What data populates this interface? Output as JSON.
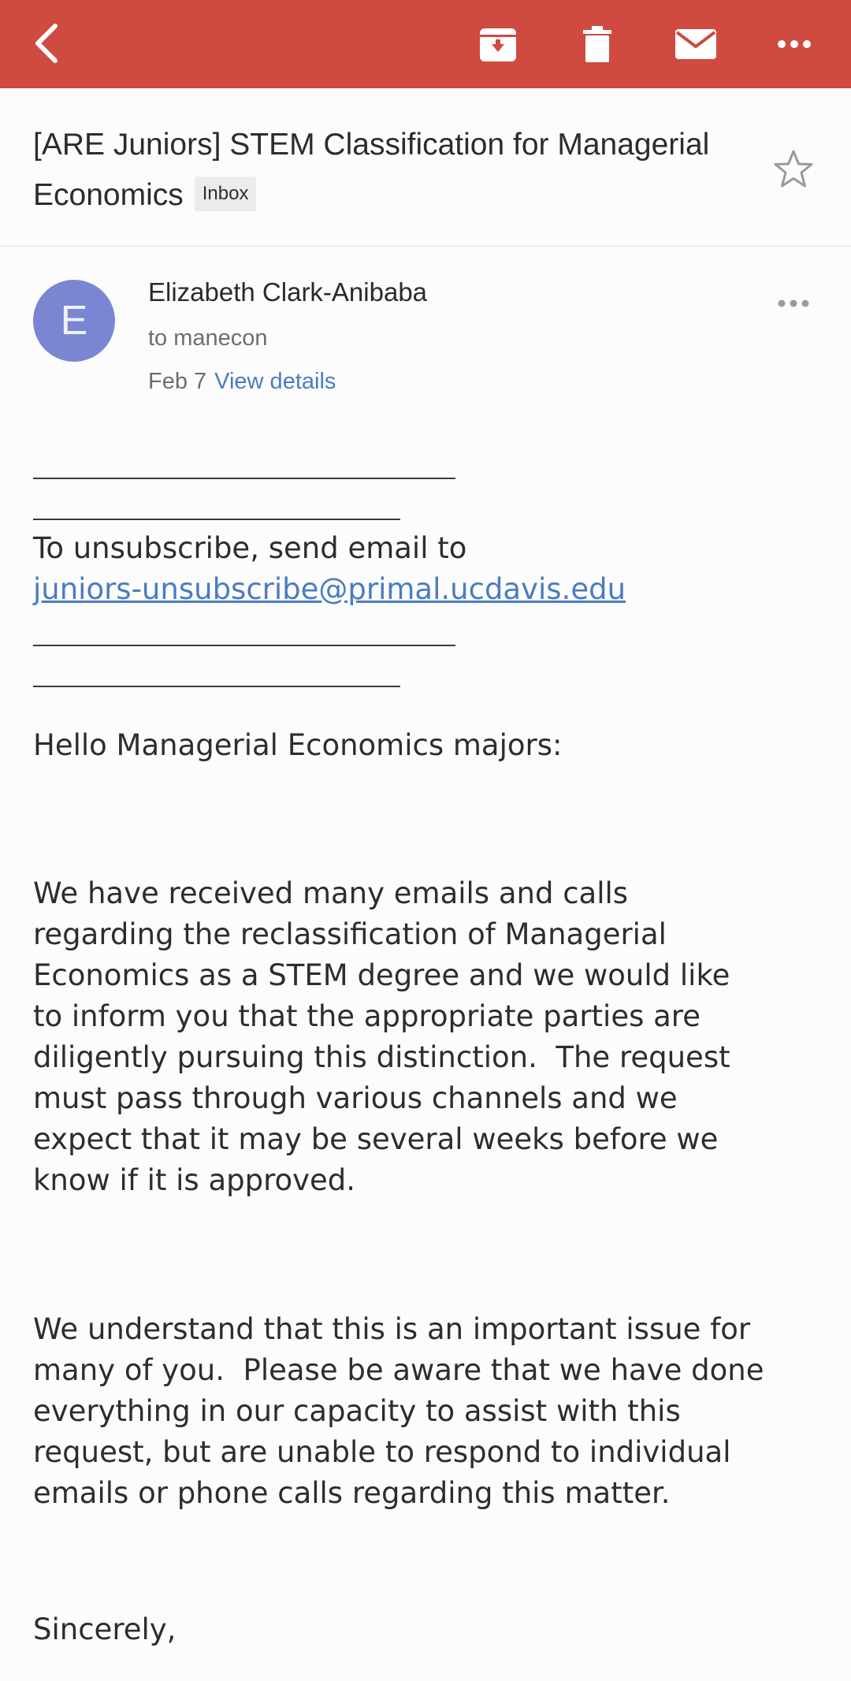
{
  "toolbar": {
    "back_icon": "chevron-left-icon",
    "archive_icon": "archive-icon",
    "delete_icon": "trash-icon",
    "mail_icon": "envelope-icon",
    "more_icon": "more-horizontal-icon",
    "bar_color": "#cf4a3f"
  },
  "email": {
    "subject": "[ARE Juniors] STEM Classification for Managerial Economics",
    "label": "Inbox",
    "avatar_letter": "E",
    "avatar_color": "#7b86d2",
    "sender": "Elizabeth Clark-Anibaba",
    "recipient": "to manecon",
    "date": "Feb 7",
    "view_details": "View details",
    "unsubscribe_text": "To unsubscribe, send email to",
    "unsubscribe_link": "juniors-unsubscribe@primal.ucdavis.edu",
    "greeting": "Hello Managerial Economics majors:",
    "para1_lines": [
      "We have received many emails and calls",
      "regarding the reclassification of Managerial",
      "Economics as a STEM degree and we would like",
      "to inform you that the appropriate parties are",
      "diligently pursuing this distinction.  The request",
      "must pass through various channels and we",
      "expect that it may be several weeks before we",
      "know if it is approved."
    ],
    "para2_lines": [
      "We understand that this is an important issue for",
      "many of you.  Please be aware that we have done",
      "everything in our capacity to assist with this",
      "request, but are unable to respond to individual",
      "emails or phone calls regarding this matter."
    ],
    "closing": "Sincerely,"
  }
}
